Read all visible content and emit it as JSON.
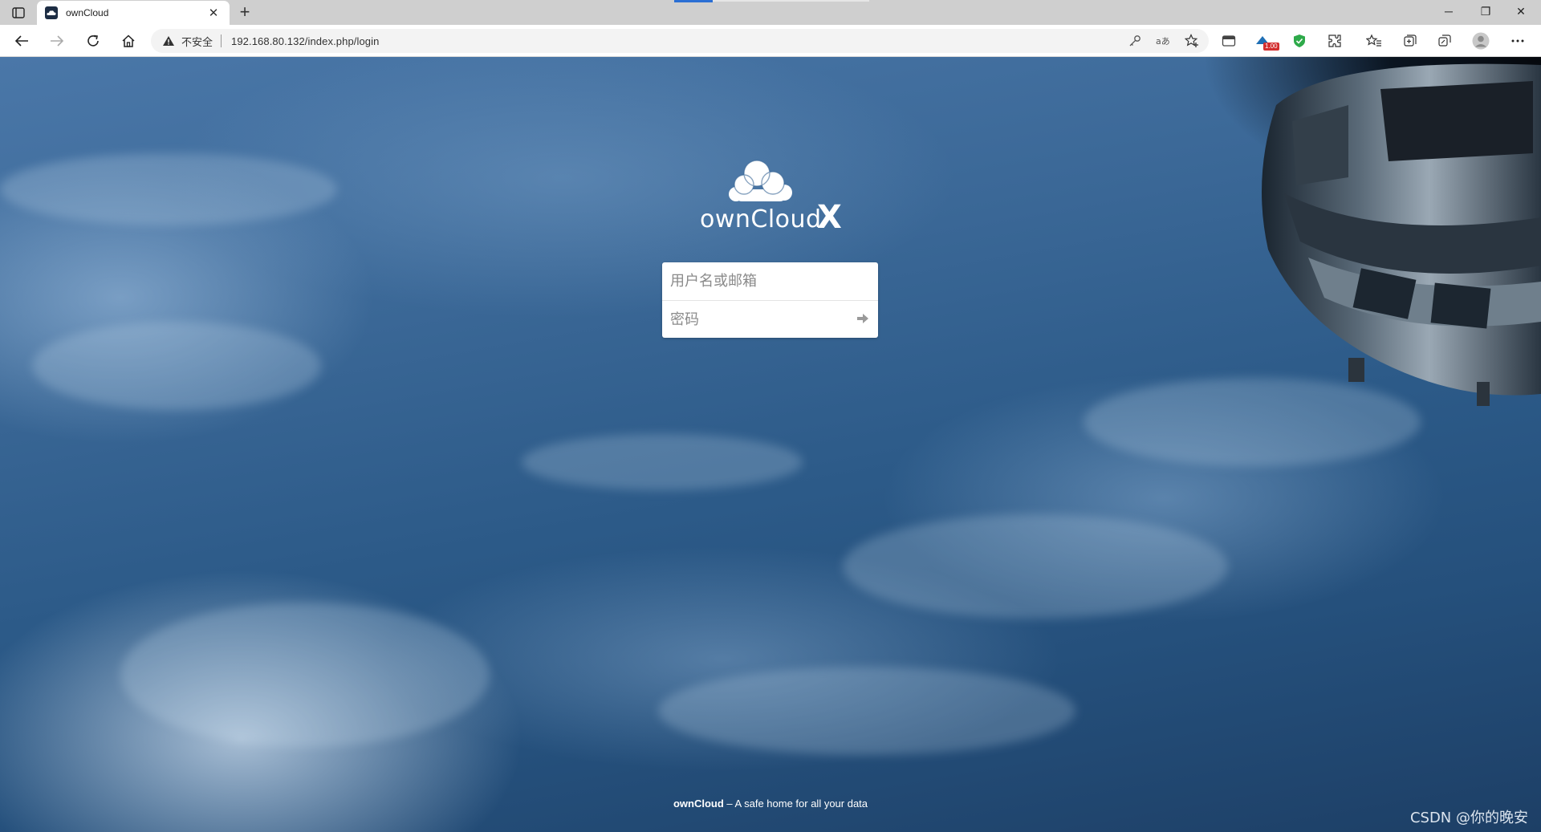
{
  "browser": {
    "tab": {
      "title": "ownCloud",
      "close_label": "✕"
    },
    "new_tab_label": "+",
    "window_controls": {
      "minimize": "─",
      "restore": "❐",
      "close": "✕"
    },
    "security_label": "不安全",
    "url": "192.168.80.132/index.php/login",
    "extension_badge": "1.00"
  },
  "page": {
    "logo_text": "ownCloud",
    "logo_suffix": "X",
    "login": {
      "username_placeholder": "用户名或邮箱",
      "password_placeholder": "密码"
    },
    "footer": {
      "brand": "ownCloud",
      "tagline": " – A safe home for all your data"
    },
    "watermark": "CSDN @你的晚安"
  },
  "colors": {
    "accent": "#2b6fd4",
    "background_top": "#4a77a8",
    "background_bottom": "#1d3f66"
  }
}
